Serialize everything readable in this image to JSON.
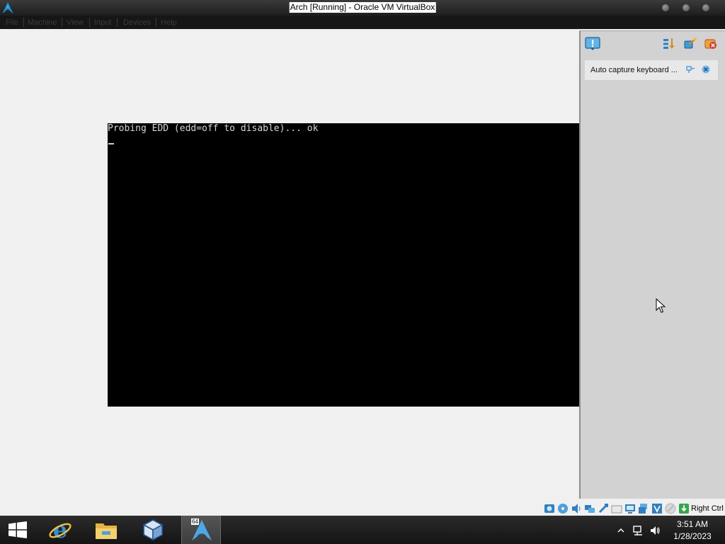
{
  "window": {
    "title": "Arch [Running] - Oracle VM VirtualBox",
    "app_icon": "arch-logo-icon",
    "controls": [
      "minimize-icon",
      "maximize-icon",
      "close-icon"
    ]
  },
  "menubar": {
    "items": [
      {
        "label": "File"
      },
      {
        "label": "Machine"
      },
      {
        "label": "View"
      },
      {
        "label": "Input"
      },
      {
        "label": "Devices"
      },
      {
        "label": "Help"
      }
    ]
  },
  "vm_screen": {
    "console_lines": [
      "Probing EDD (edd=off to disable)... ok"
    ],
    "cursor_glyph": "_",
    "background": "#000000",
    "text_color": "#d6d6d6"
  },
  "notification_center": {
    "header_icon": "notification-center-icon",
    "tools": [
      "sort-icon",
      "toggle-all-icon",
      "delete-all-icon"
    ],
    "messages": [
      {
        "text": "Auto capture keyboard ...",
        "icons": [
          "pin-icon",
          "close-icon"
        ]
      }
    ]
  },
  "statusbar": {
    "icons": [
      "hard-disk-icon",
      "optical-drive-icon",
      "audio-icon",
      "network-icon",
      "usb-icon",
      "shared-folders-icon",
      "display-icon",
      "video-capture-icon",
      "virtualization-icon",
      "mouse-integration-icon",
      "keyboard-icon"
    ],
    "host_key": "Right Ctrl"
  },
  "taskbar": {
    "start": "windows-start-icon",
    "pinned": [
      {
        "name": "internet-explorer-icon"
      },
      {
        "name": "file-explorer-icon"
      },
      {
        "name": "virtualbox-icon"
      },
      {
        "name": "arch-vm-icon",
        "badge": "64",
        "active": true
      }
    ],
    "tray": [
      "show-hidden-icons-icon",
      "network-icon",
      "volume-icon"
    ],
    "clock": {
      "time": "3:51 AM",
      "date": "1/28/2023"
    }
  },
  "colors": {
    "desktop_bg": "#f0f0f0",
    "titlebar_bg": "#262626",
    "panel_bg": "#d2d2d2",
    "taskbar_bg": "#1b1b1b",
    "accent_blue": "#1a8ad4"
  }
}
